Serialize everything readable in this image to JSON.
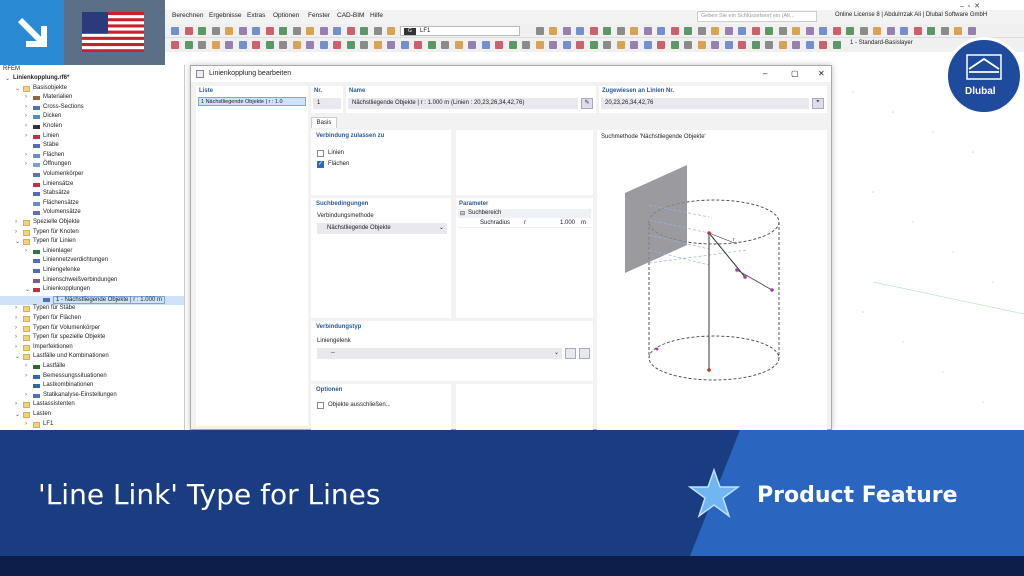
{
  "menu": [
    "Berechnen",
    "Ergebnisse",
    "Extras",
    "Optionen",
    "Fenster",
    "CAD-BIM",
    "Hilfe"
  ],
  "search": {
    "placeholder": "Geben Sie ein Schlüsselwort ein (Alt..."
  },
  "license": "Online License 8 | Abdulrrzak Ali | Dlubal Software GmbH",
  "load_case": {
    "tag": "G",
    "value": "LF1"
  },
  "layer": "1 - Standard-Basislayer",
  "navigator": {
    "title": "RFEM",
    "items": [
      {
        "label": "Linienkopplung.rf6*",
        "level": 0,
        "bold": true,
        "toggle": "⌄"
      },
      {
        "label": "Basisobjekte",
        "level": 1,
        "icon": "folder",
        "toggle": "⌄"
      },
      {
        "label": "Materialien",
        "level": 2,
        "icon": "material",
        "toggle": "›"
      },
      {
        "label": "Cross-Sections",
        "level": 2,
        "icon": "section",
        "toggle": "›"
      },
      {
        "label": "Dicken",
        "level": 2,
        "icon": "thickness",
        "toggle": "›"
      },
      {
        "label": "Knoten",
        "level": 2,
        "icon": "node",
        "toggle": "›"
      },
      {
        "label": "Linien",
        "level": 2,
        "icon": "line",
        "toggle": "›"
      },
      {
        "label": "Stäbe",
        "level": 2,
        "icon": "member",
        "toggle": ""
      },
      {
        "label": "Flächen",
        "level": 2,
        "icon": "surface",
        "toggle": "›"
      },
      {
        "label": "Öffnungen",
        "level": 2,
        "icon": "opening",
        "toggle": "›"
      },
      {
        "label": "Volumenkörper",
        "level": 2,
        "icon": "solid",
        "toggle": ""
      },
      {
        "label": "Liniensätze",
        "level": 2,
        "icon": "lineset",
        "toggle": ""
      },
      {
        "label": "Stabsätze",
        "level": 2,
        "icon": "memberset",
        "toggle": ""
      },
      {
        "label": "Flächensätze",
        "level": 2,
        "icon": "surfaceset",
        "toggle": ""
      },
      {
        "label": "Volumensätze",
        "level": 2,
        "icon": "solidset",
        "toggle": ""
      },
      {
        "label": "Spezielle Objekte",
        "level": 1,
        "icon": "folder",
        "toggle": "›"
      },
      {
        "label": "Typen für Knoten",
        "level": 1,
        "icon": "folder",
        "toggle": "›"
      },
      {
        "label": "Typen für Linien",
        "level": 1,
        "icon": "folder",
        "toggle": "⌄"
      },
      {
        "label": "Linienlager",
        "level": 2,
        "icon": "support",
        "toggle": "›"
      },
      {
        "label": "Liniennetzverdichtungen",
        "level": 2,
        "icon": "mesh",
        "toggle": ""
      },
      {
        "label": "Liniengelenke",
        "level": 2,
        "icon": "hinge",
        "toggle": ""
      },
      {
        "label": "Linienschweißverbindungen",
        "level": 2,
        "icon": "weld",
        "toggle": ""
      },
      {
        "label": "Linienkopplungen",
        "level": 2,
        "icon": "link",
        "toggle": "⌄"
      },
      {
        "label": "1 - Nächstliegende Objekte | r : 1.000 m",
        "level": 3,
        "icon": "item",
        "toggle": "",
        "selected": true
      },
      {
        "label": "Typen für Stäbe",
        "level": 1,
        "icon": "folder",
        "toggle": "›"
      },
      {
        "label": "Typen für Flächen",
        "level": 1,
        "icon": "folder",
        "toggle": "›"
      },
      {
        "label": "Typen für Volumenkörper",
        "level": 1,
        "icon": "folder",
        "toggle": "›"
      },
      {
        "label": "Typen für spezielle Objekte",
        "level": 1,
        "icon": "folder",
        "toggle": "›"
      },
      {
        "label": "Imperfektionen",
        "level": 1,
        "icon": "folder",
        "toggle": "›"
      },
      {
        "label": "Lastfälle und Kombinationen",
        "level": 1,
        "icon": "folder",
        "toggle": "⌄"
      },
      {
        "label": "Lastfälle",
        "level": 2,
        "icon": "loadcase",
        "toggle": "›"
      },
      {
        "label": "Bemessungssituationen",
        "level": 2,
        "icon": "design",
        "toggle": "›"
      },
      {
        "label": "Lastkombinationen",
        "level": 2,
        "icon": "combo",
        "toggle": ""
      },
      {
        "label": "Statikanalyse-Einstellungen",
        "level": 2,
        "icon": "settings",
        "toggle": "›"
      },
      {
        "label": "Lastassistenten",
        "level": 1,
        "icon": "folder",
        "toggle": "›"
      },
      {
        "label": "Lasten",
        "level": 1,
        "icon": "folder",
        "toggle": "⌄"
      },
      {
        "label": "LF1",
        "level": 2,
        "icon": "folder",
        "toggle": "›"
      }
    ]
  },
  "dialog": {
    "title": "Linienkopplung bearbeiten",
    "list_header": "Liste",
    "list_item": "1  Nächstliegende Objekte | r : 1.0",
    "nr_label": "Nr.",
    "nr_value": "1",
    "name_label": "Name",
    "name_value": "Nächstliegende Objekte | r : 1.000 m (Linien : 20,23,26,34,42,76)",
    "assigned_label": "Zugewiesen an Linien Nr.",
    "assigned_value": "20,23,26,34,42,76",
    "tab": "Basis",
    "conn_header": "Verbindung zulassen zu",
    "cb_lines": "Linien",
    "cb_surfaces": "Flächen",
    "search_header": "Suchbedingungen",
    "method_label": "Verbindungsmethode",
    "method_value": "Nächstliegende Objekte",
    "param_header": "Parameter",
    "param_group": "Suchbereich",
    "param_name": "Suchradius",
    "param_symbol": "r",
    "param_value": "1.000",
    "param_unit": "m",
    "conntype_header": "Verbindungstyp",
    "hinge_label": "Liniengelenk",
    "hinge_value": "--",
    "options_header": "Optionen",
    "exclude_label": "Objekte ausschließen...",
    "preview_title": "Suchmethode 'Nächstliegende Objekte'",
    "preview_r": "r"
  },
  "logo": "Dlubal",
  "banner": {
    "title": "'Line Link' Type for Lines",
    "feature": "Product Feature"
  },
  "colors": {
    "accent": "#2a8ad3",
    "banner": "#1a3d82",
    "banner_right": "#2a66c0",
    "header_text": "#2a5a9a",
    "checkbox": "#2a6bc8"
  }
}
